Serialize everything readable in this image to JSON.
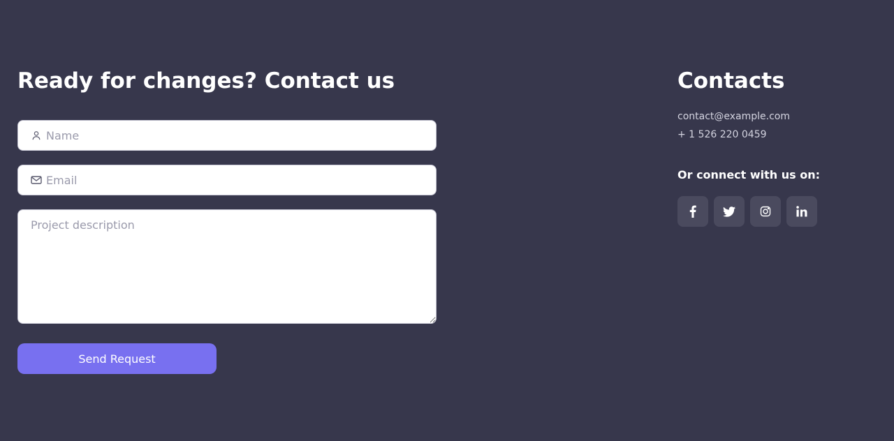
{
  "form": {
    "title": "Ready for changes? Contact us",
    "name_placeholder": "Name",
    "email_placeholder": "Email",
    "description_placeholder": "Project description",
    "submit_label": "Send Request",
    "icons": {
      "name": "user-icon",
      "email": "mail-icon"
    }
  },
  "contacts": {
    "title": "Contacts",
    "email": "contact@example.com",
    "phone": "+ 1 526 220 0459",
    "connect_label": "Or connect with us on:",
    "socials": [
      {
        "icon": "facebook-icon"
      },
      {
        "icon": "twitter-icon"
      },
      {
        "icon": "instagram-icon"
      },
      {
        "icon": "linkedin-icon"
      }
    ]
  },
  "colors": {
    "background": "#37374c",
    "accent": "#7870f0",
    "social_button_bg": "#4a4a5e",
    "field_bg": "#ffffff"
  }
}
